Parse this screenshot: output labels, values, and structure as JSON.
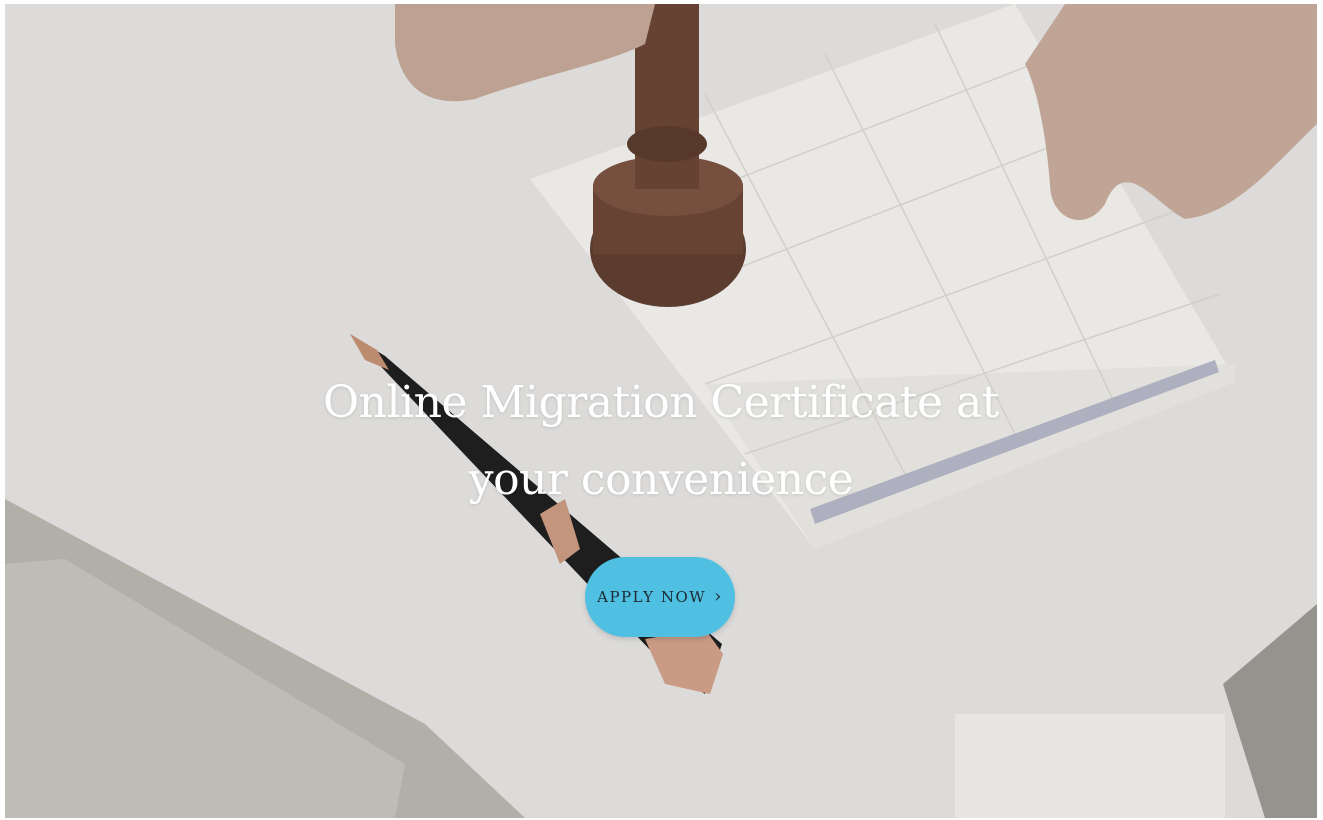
{
  "hero": {
    "title": "Online Migration Certificate at your convenience",
    "background_image": "hand-stamping-document-with-pen-on-desk",
    "cta_label": "APPLY NOW",
    "cta_icon": "chevron-right-icon",
    "cta_chevron": "›"
  },
  "colors": {
    "cta_background": "#4fbfe2",
    "title_text": "#ffffff",
    "cta_text": "#1e2a33"
  }
}
